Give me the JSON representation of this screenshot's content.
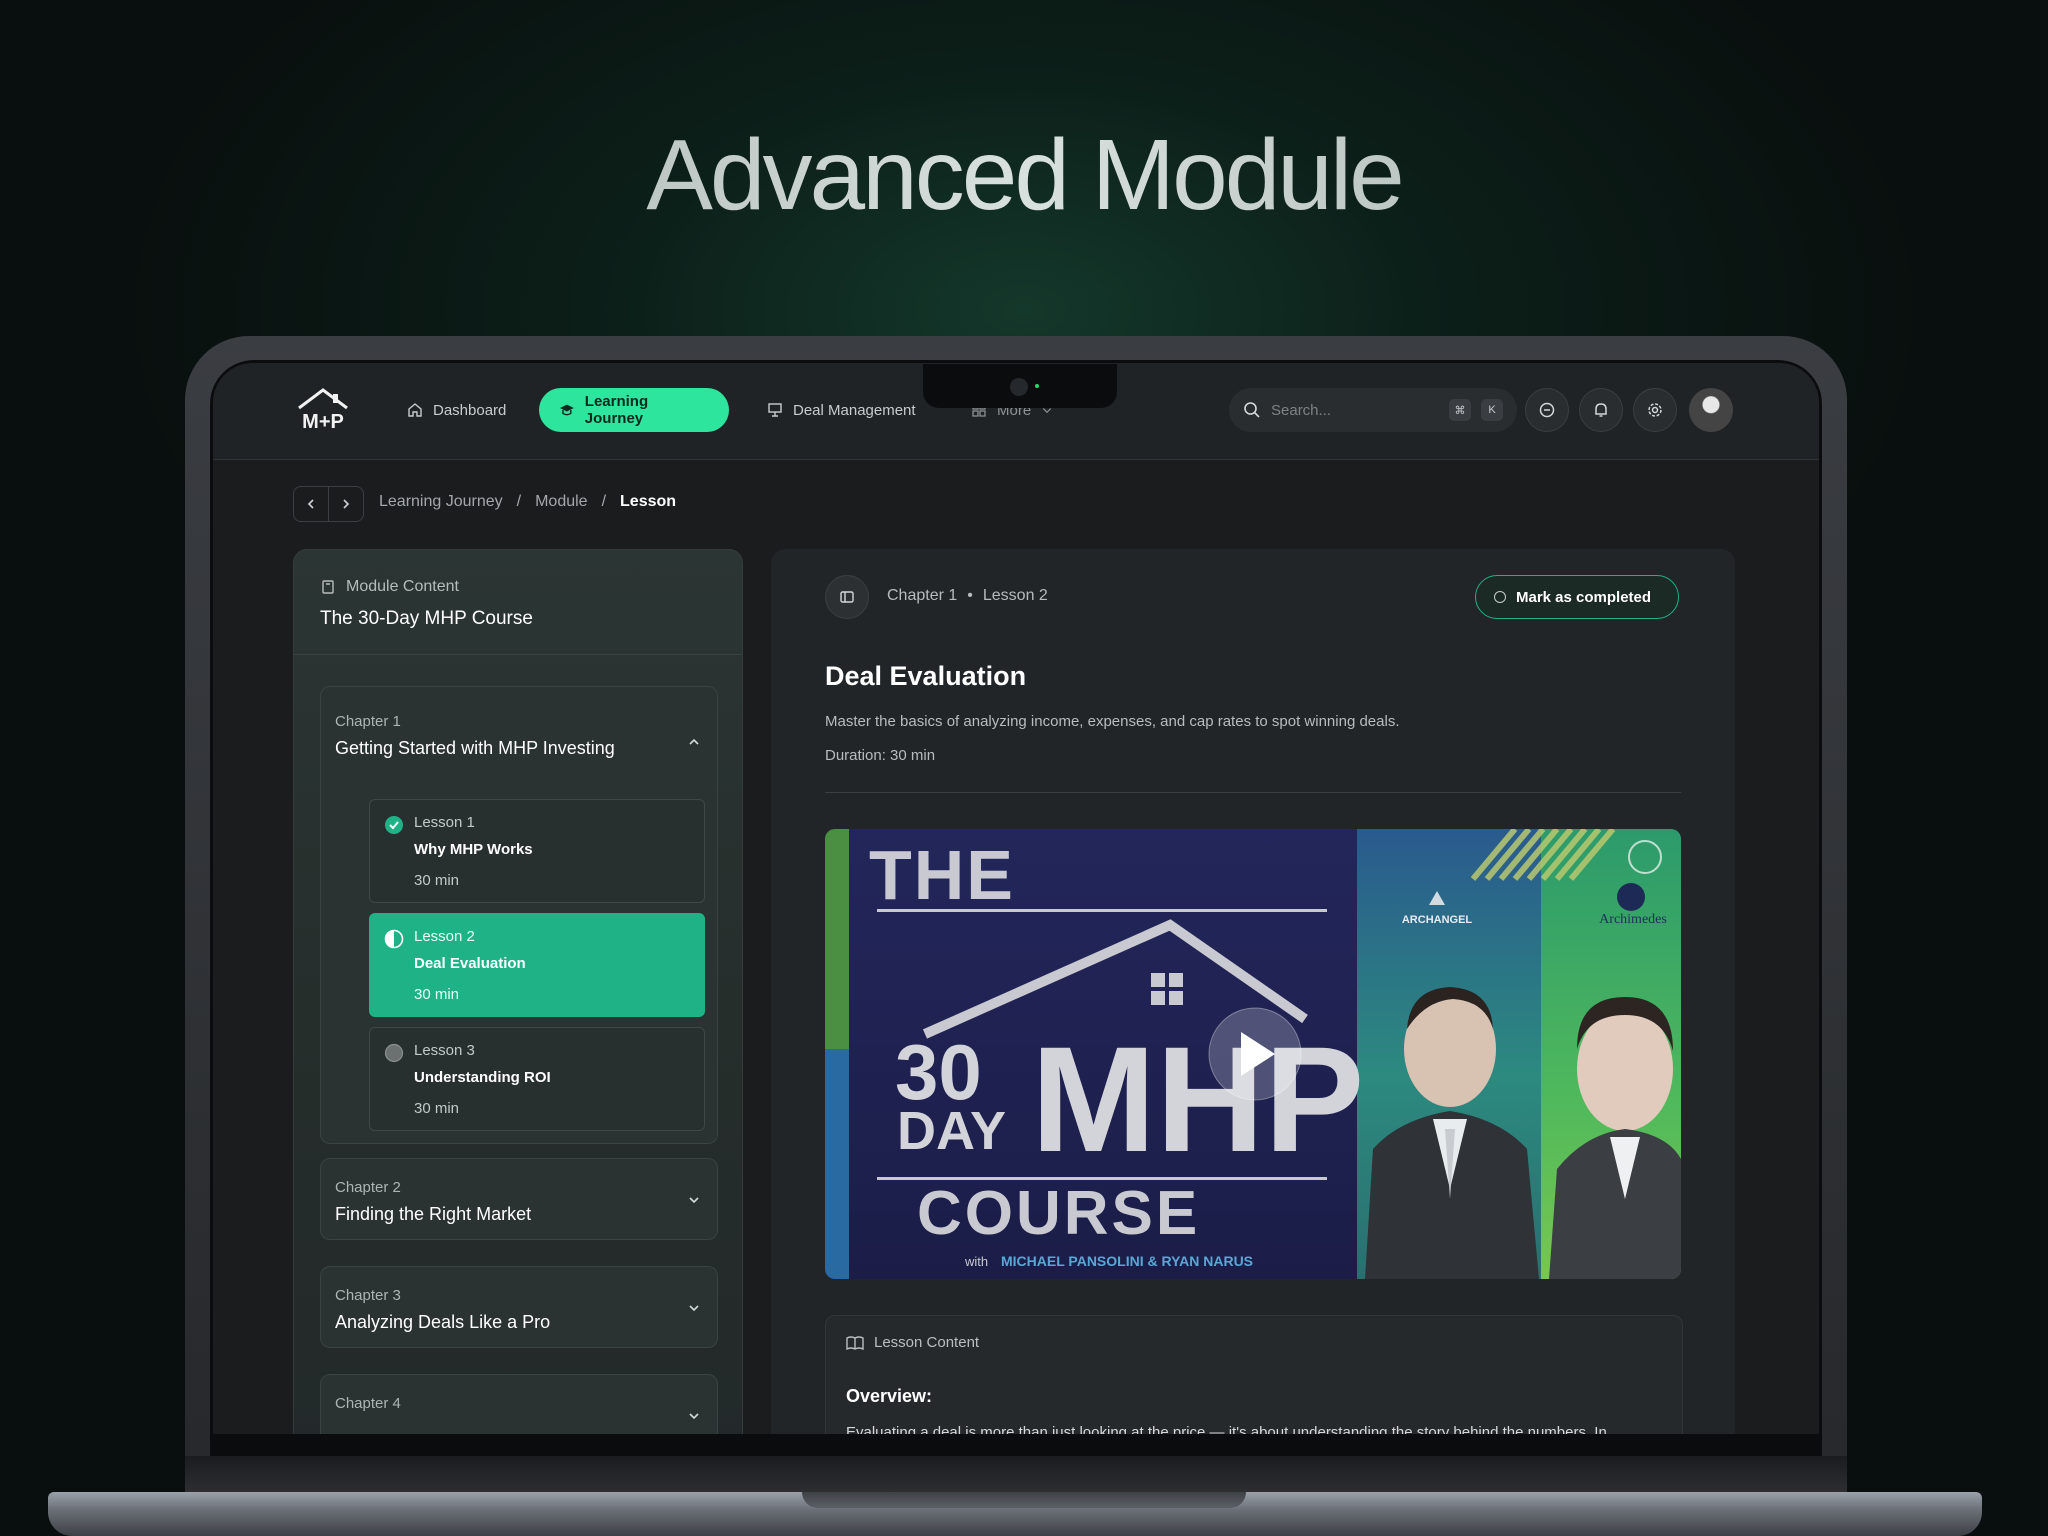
{
  "hero": {
    "title": "Advanced Module"
  },
  "nav": {
    "logo_text": "M+P",
    "items": [
      {
        "label": "Dashboard",
        "icon": "home-icon"
      },
      {
        "label": "Learning Journey",
        "icon": "graduation-cap-icon",
        "active": true
      },
      {
        "label": "Deal Management",
        "icon": "presentation-icon"
      },
      {
        "label": "More",
        "icon": "grid-icon"
      }
    ],
    "search": {
      "placeholder": "Search...",
      "shortcut_keys": [
        "⌘",
        "K"
      ]
    },
    "accent": "#2ee59d"
  },
  "breadcrumb": {
    "items": [
      "Learning Journey",
      "Module",
      "Lesson"
    ],
    "separator": "/"
  },
  "module": {
    "kicker": "Module Content",
    "title": "The 30-Day MHP Course",
    "chapters": [
      {
        "number": "Chapter 1",
        "title": "Getting Started with MHP Investing",
        "expanded": true,
        "lessons": [
          {
            "number": "Lesson 1",
            "title": "Why MHP Works",
            "duration": "30 min",
            "status": "completed"
          },
          {
            "number": "Lesson 2",
            "title": "Deal Evaluation",
            "duration": "30 min",
            "status": "in-progress"
          },
          {
            "number": "Lesson 3",
            "title": "Understanding ROI",
            "duration": "30 min",
            "status": "not-started"
          }
        ]
      },
      {
        "number": "Chapter 2",
        "title": "Finding the Right Market",
        "expanded": false
      },
      {
        "number": "Chapter 3",
        "title": "Analyzing Deals Like a Pro",
        "expanded": false
      },
      {
        "number": "Chapter 4",
        "title": "",
        "expanded": false
      }
    ]
  },
  "lesson": {
    "chapter": "Chapter 1",
    "bullet": "•",
    "lesson": "Lesson 2",
    "mark_label": "Mark as completed",
    "title": "Deal Evaluation",
    "description": "Master the basics of analyzing income, expenses, and cap rates to spot winning deals.",
    "duration": "Duration: 30 min",
    "video": {
      "line1": "THE",
      "day_number": "30",
      "day_word": "DAY",
      "brand": "MHP",
      "line3": "COURSE",
      "byline_with": "with",
      "byline_names": "MICHAEL PANSOLINI & RYAN NARUS",
      "logo_left": "ARCHANGEL",
      "logo_right": "Archimedes"
    },
    "content_label": "Lesson Content",
    "overview_heading": "Overview:",
    "overview_text": "Evaluating a deal is more than just looking at the price — it's about understanding the story behind the numbers. In"
  }
}
